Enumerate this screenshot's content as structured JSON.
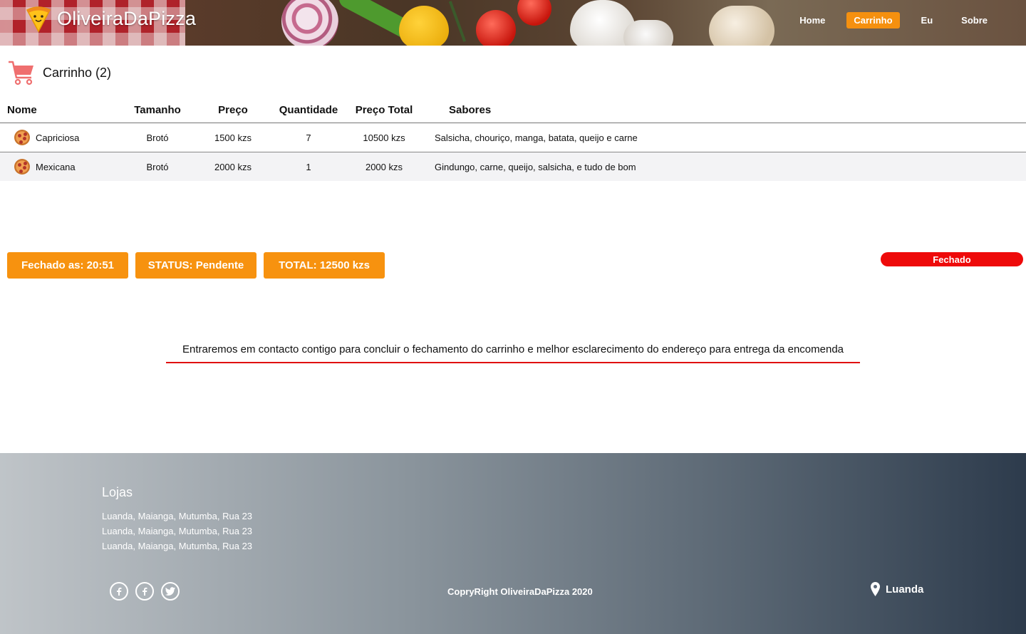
{
  "brand": {
    "name": "OliveiraDaPizza"
  },
  "nav": {
    "items": [
      {
        "label": "Home",
        "active": false
      },
      {
        "label": "Carrinho",
        "active": true
      },
      {
        "label": "Eu",
        "active": false
      },
      {
        "label": "Sobre",
        "active": false
      }
    ]
  },
  "cart": {
    "title": "Carrinho (2)",
    "columns": {
      "name": "Nome",
      "size": "Tamanho",
      "price": "Preço",
      "quantity": "Quantidade",
      "total": "Preço Total",
      "flavors": "Sabores"
    },
    "rows": [
      {
        "name": "Capriciosa",
        "size": "Brotó",
        "price": "1500 kzs",
        "quantity": "7",
        "total": "10500 kzs",
        "flavors": "Salsicha, chouriço, manga, batata, queijo e carne"
      },
      {
        "name": "Mexicana",
        "size": "Brotó",
        "price": "2000 kzs",
        "quantity": "1",
        "total": "2000 kzs",
        "flavors": "Gindungo, carne, queijo, salsicha, e tudo de bom"
      }
    ]
  },
  "summary": {
    "closed_at": "Fechado as: 20:51",
    "status": "STATUS: Pendente",
    "total": "TOTAL: 12500 kzs",
    "badge": "Fechado"
  },
  "notice": "Entraremos em contacto contigo para concluir o fechamento do carrinho e melhor esclarecimento do endereço para entrega da encomenda",
  "footer": {
    "stores_title": "Lojas",
    "addresses": [
      "Luanda, Maianga, Mutumba, Rua 23",
      "Luanda, Maianga, Mutumba, Rua 23",
      "Luanda, Maianga, Mutumba, Rua 23"
    ],
    "socials": [
      "facebook-icon",
      "facebook-icon",
      "twitter-icon"
    ],
    "copyright": "CopryRight OliveiraDaPizza 2020",
    "location": "Luanda"
  },
  "colors": {
    "accent": "#f7920f",
    "closed": "#ee0a0a",
    "notice_underline": "#e01010"
  }
}
